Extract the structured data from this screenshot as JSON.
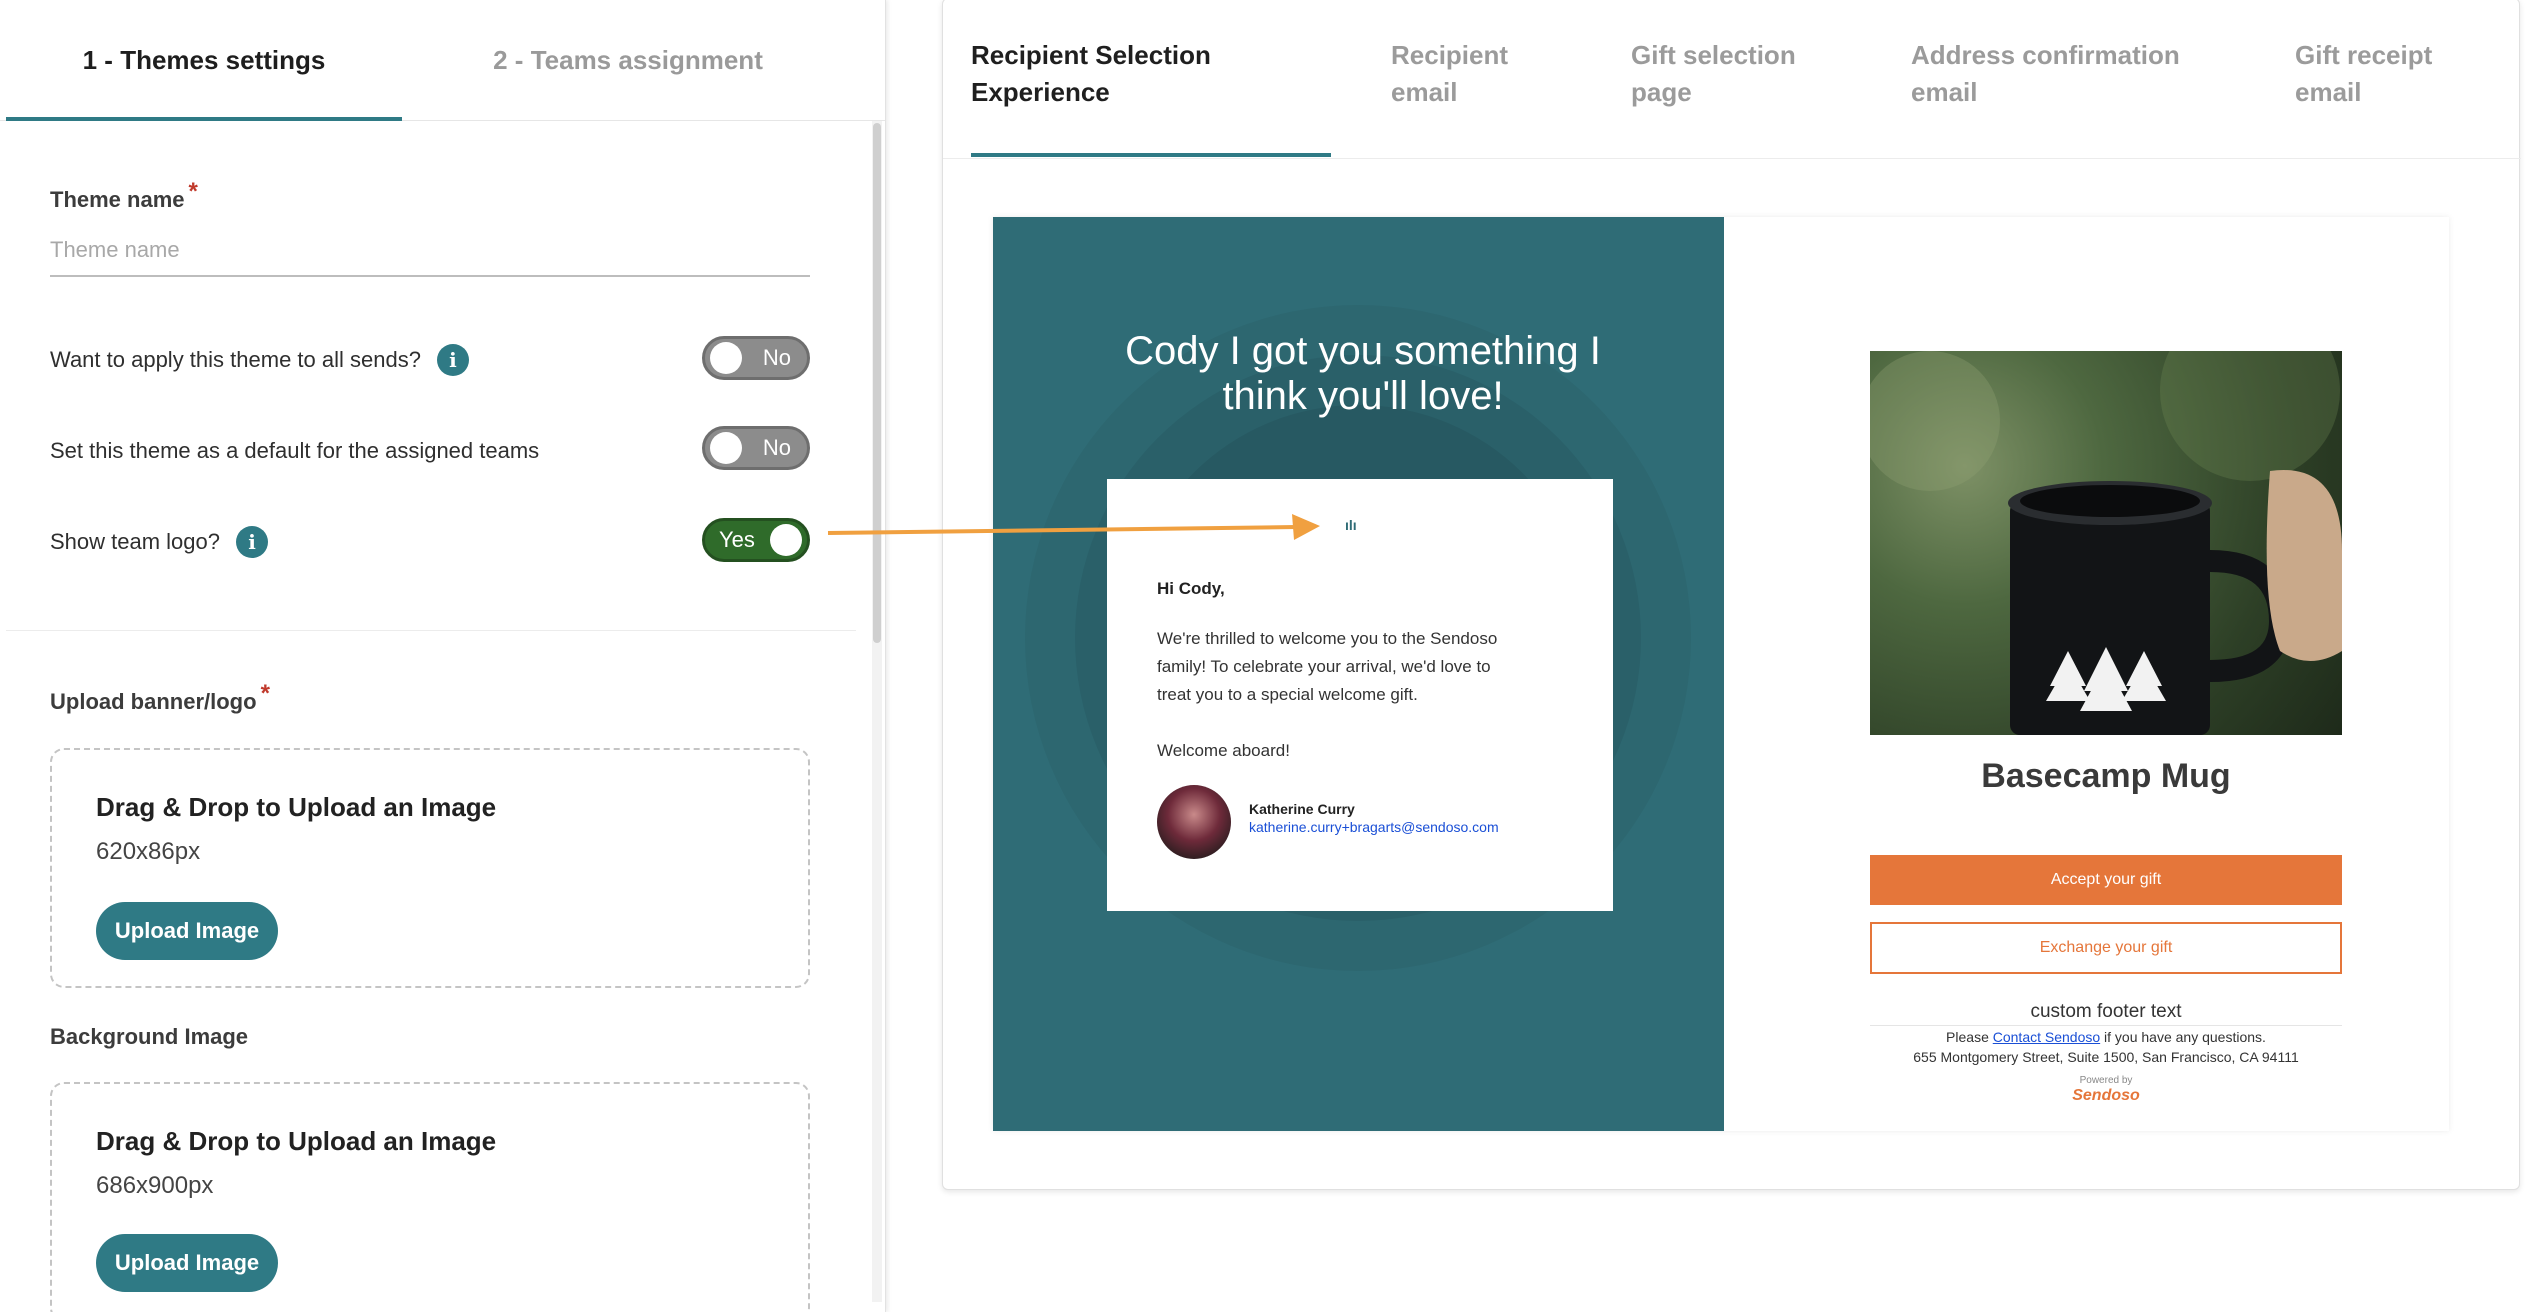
{
  "left_panel": {
    "tabs": [
      {
        "label": "1 - Themes settings"
      },
      {
        "label": "2 - Teams assignment"
      }
    ],
    "theme_name": {
      "label": "Theme name",
      "required": "*",
      "placeholder": "Theme name",
      "value": ""
    },
    "options": [
      {
        "label": "Want to apply this theme to all sends?",
        "has_info": true,
        "toggle_state": "off",
        "toggle_label": "No"
      },
      {
        "label": "Set this theme as a default for the assigned teams",
        "has_info": false,
        "toggle_state": "off",
        "toggle_label": "No"
      },
      {
        "label": "Show team logo?",
        "has_info": true,
        "toggle_state": "on",
        "toggle_label": "Yes"
      }
    ],
    "info_icon_glyph": "i",
    "banner_upload": {
      "label": "Upload banner/logo",
      "required": "*",
      "title": "Drag & Drop to Upload an Image",
      "dimensions": "620x86px",
      "button": "Upload Image"
    },
    "background_upload": {
      "label": "Background Image",
      "title": "Drag & Drop to Upload an Image",
      "dimensions": "686x900px",
      "button": "Upload Image"
    }
  },
  "right_panel": {
    "tabs": [
      {
        "label_line1": "Recipient Selection",
        "label_line2": "Experience",
        "active": true
      },
      {
        "label_line1": "Recipient",
        "label_line2": "email",
        "active": false
      },
      {
        "label_line1": "Gift selection",
        "label_line2": "page",
        "active": false
      },
      {
        "label_line1": "Address confirmation",
        "label_line2": "email",
        "active": false
      },
      {
        "label_line1": "Gift receipt",
        "label_line2": "email",
        "active": false
      }
    ],
    "preview": {
      "headline_line1": "Cody I got you something I",
      "headline_line2": "think you'll love!",
      "card": {
        "logo_text": "ılı",
        "greeting": "Hi Cody,",
        "body_line1": "We're thrilled to welcome you to the Sendoso",
        "body_line2": "family! To celebrate your arrival, we'd love to",
        "body_line3": "treat you to a special welcome gift.",
        "closing": "Welcome aboard!",
        "sender_name": "Katherine Curry",
        "sender_email": "katherine.curry+bragarts@sendoso.com"
      },
      "product": {
        "title": "Basecamp Mug",
        "accept_button": "Accept your gift",
        "exchange_button": "Exchange your gift",
        "footer_text": "custom footer text",
        "contact_prefix": "Please",
        "contact_link": "Contact Sendoso",
        "contact_suffix": "if you have any questions.",
        "address": "655 Montgomery Street, Suite 1500, San Francisco, CA 94111",
        "powered_by": "Powered by",
        "brand": "Sendoso"
      }
    }
  },
  "colors": {
    "accent_teal": "#2f7a85",
    "preview_teal": "#2f6c76",
    "toggle_on": "#2f6b2a",
    "gift_orange": "#e5763a",
    "annotation_arrow": "#f0a040"
  }
}
